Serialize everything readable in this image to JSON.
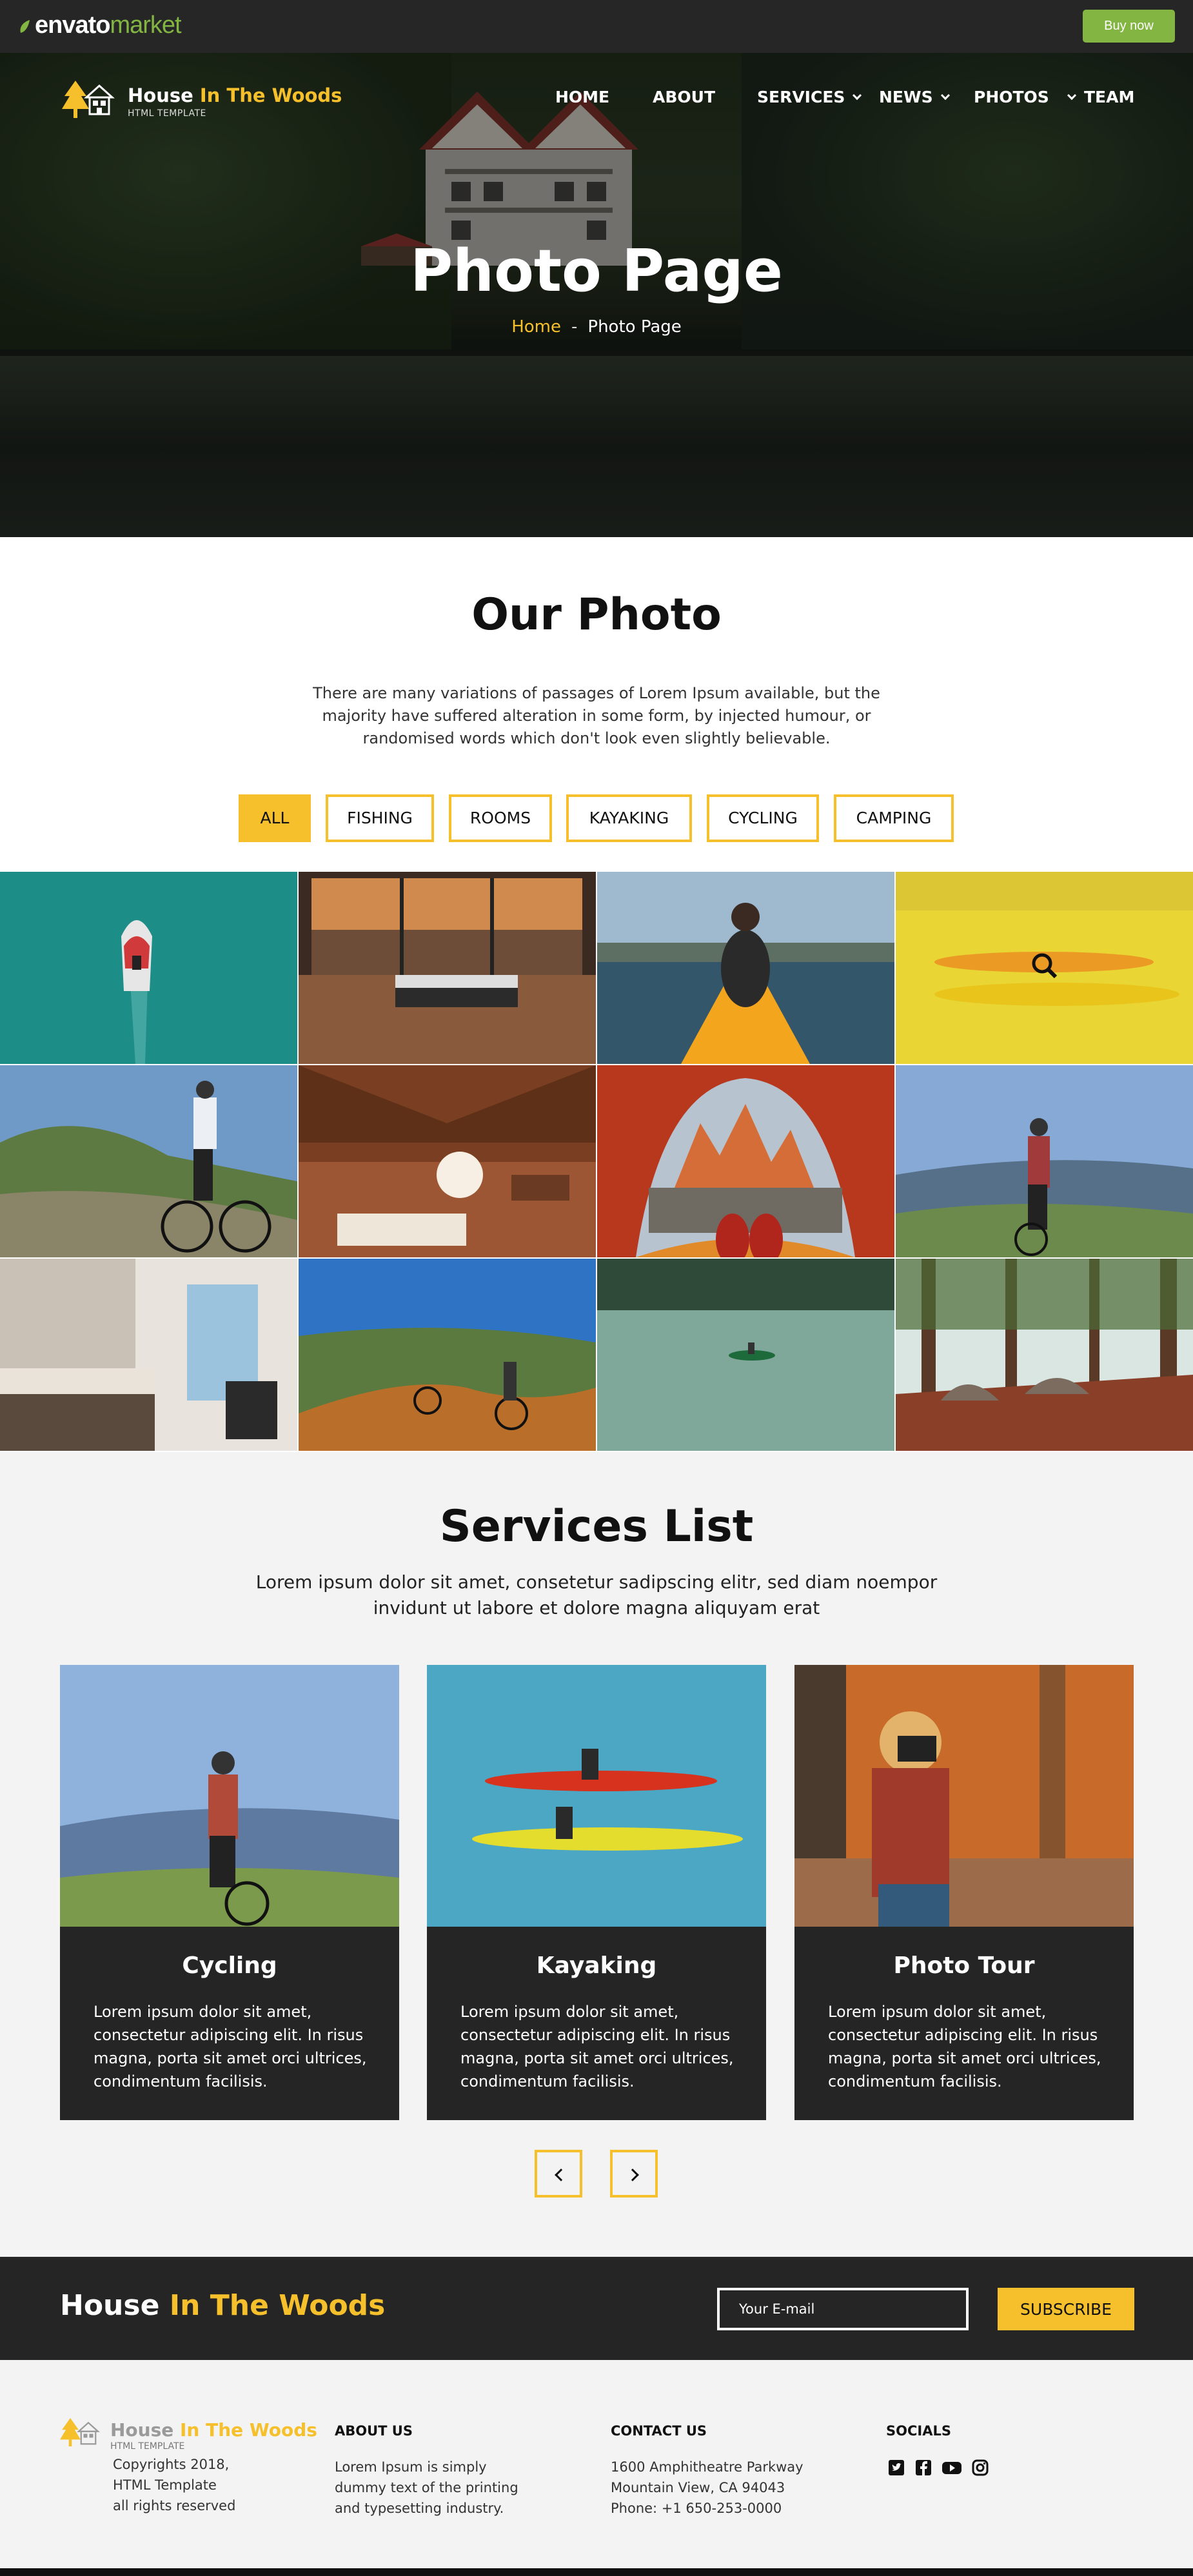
{
  "envato": {
    "logo_main": "envato",
    "logo_sub": "market",
    "buy_now": "Buy now",
    "accent": "#82b541"
  },
  "brand": {
    "name_a": "House",
    "name_b": "In The Woods",
    "tagline": "HTML TEMPLATE",
    "accent": "#f5c02b"
  },
  "nav": {
    "home": "HOME",
    "about": "ABOUT",
    "services": "SERVICES",
    "news": "NEWS",
    "photos": "PHOTOS",
    "team": "TEAM"
  },
  "hero": {
    "title": "Photo Page",
    "crumb_home": "Home",
    "crumb_sep": "-",
    "crumb_current": "Photo Page"
  },
  "photo_section": {
    "title": "Our Photo",
    "intro": "There are many variations of passages of Lorem Ipsum available, but the majority have suffered alteration in some form, by injected humour, or randomised words which don't look even slightly believable.",
    "filters": [
      "ALL",
      "FISHING",
      "ROOMS",
      "KAYAKING",
      "CYCLING",
      "CAMPING"
    ],
    "active_filter": "ALL"
  },
  "gallery": [
    "boat-photo",
    "bedroom-photo",
    "kayak-photo",
    "yellow-kayak-photo",
    "cyclist-mountain-photo",
    "attic-bedroom-photo",
    "tent-view-photo",
    "cyclist-valley-photo",
    "hotel-room-photo",
    "bike-trail-photo",
    "lake-canoe-photo",
    "forest-camp-photo"
  ],
  "services": {
    "title": "Services List",
    "intro": "Lorem ipsum dolor sit amet, consetetur sadipscing elitr, sed diam noempor invidunt ut labore et dolore magna aliquyam erat",
    "cards": [
      {
        "title": "Cycling",
        "text": "Lorem ipsum dolor sit amet, consectetur adipiscing elit. In risus magna, porta sit amet orci ultrices, condimentum facilisis."
      },
      {
        "title": "Kayaking",
        "text": "Lorem ipsum dolor sit amet, consectetur adipiscing elit. In risus magna, porta sit amet orci ultrices, condimentum facilisis."
      },
      {
        "title": "Photo Tour",
        "text": "Lorem ipsum dolor sit amet, consectetur adipiscing elit. In risus magna, porta sit amet orci ultrices, condimentum facilisis."
      }
    ]
  },
  "subscribe": {
    "name_a": "House",
    "name_b": "In The Woods",
    "email_placeholder": "Your E-mail",
    "button": "SUBSCRIBE"
  },
  "footer": {
    "copyright": [
      "Copyrights 2018,",
      "HTML Template",
      "all rights reserved"
    ],
    "about_title": "ABOUT US",
    "about_text": "Lorem Ipsum is simply dummy text of the printing and typesetting industry.",
    "contact_title": "CONTACT US",
    "contact_lines": [
      "1600 Amphitheatre Parkway",
      "Mountain View, CA 94043",
      "Phone: +1 650-253-0000"
    ],
    "socials_title": "SOCIALS",
    "socials": [
      "twitter-icon",
      "facebook-icon",
      "youtube-icon",
      "instagram-icon"
    ]
  }
}
